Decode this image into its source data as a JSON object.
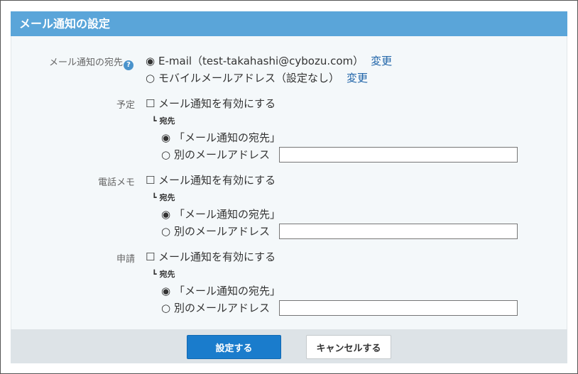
{
  "title": "メール通知の設定",
  "destination": {
    "label": "メール通知の宛先",
    "help_icon": "?",
    "email_option": "E-mail（test-takahashi@cybozu.com）",
    "email_change": "変更",
    "mobile_option": "モバイルメールアドレス（設定なし）",
    "mobile_change": "変更"
  },
  "glyphs": {
    "radio_on": "◉",
    "radio_off": "○",
    "checkbox": "☐",
    "branch": "┗"
  },
  "sections": [
    {
      "label": "予定",
      "enable": "メール通知を有効にする",
      "sub_label": "宛先",
      "option_default": "「メール通知の宛先」",
      "option_other": "別のメールアドレス",
      "other_value": ""
    },
    {
      "label": "電話メモ",
      "enable": "メール通知を有効にする",
      "sub_label": "宛先",
      "option_default": "「メール通知の宛先」",
      "option_other": "別のメールアドレス",
      "other_value": ""
    },
    {
      "label": "申請",
      "enable": "メール通知を有効にする",
      "sub_label": "宛先",
      "option_default": "「メール通知の宛先」",
      "option_other": "別のメールアドレス",
      "other_value": ""
    }
  ],
  "buttons": {
    "submit": "設定する",
    "cancel": "キャンセルする"
  }
}
